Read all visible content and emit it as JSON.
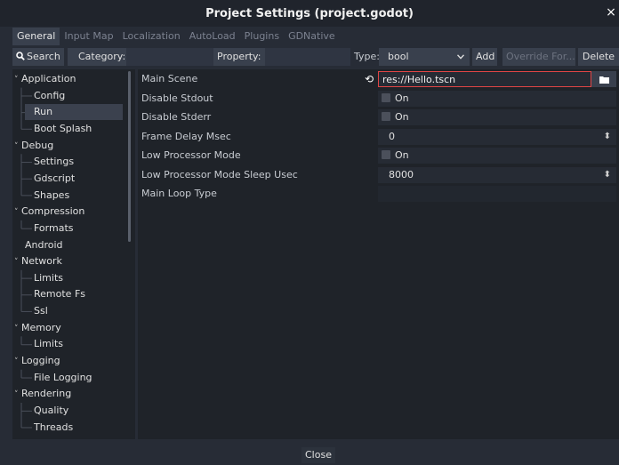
{
  "window": {
    "title": "Project Settings (project.godot)",
    "close_glyph": "×"
  },
  "tabs": [
    {
      "label": "General",
      "active": true
    },
    {
      "label": "Input Map"
    },
    {
      "label": "Localization"
    },
    {
      "label": "AutoLoad"
    },
    {
      "label": "Plugins"
    },
    {
      "label": "GDNative"
    }
  ],
  "toolbar": {
    "search_label": "Search",
    "category_label": "Category:",
    "category_value": "",
    "property_label": "Property:",
    "property_value": "",
    "type_label": "Type:",
    "type_value": "bool",
    "add_label": "Add",
    "override_label": "Override For...",
    "delete_label": "Delete"
  },
  "tree": [
    {
      "label": "Application",
      "level": 0,
      "expanded": true
    },
    {
      "label": "Config",
      "level": 1
    },
    {
      "label": "Run",
      "level": 1,
      "selected": true
    },
    {
      "label": "Boot Splash",
      "level": 1
    },
    {
      "label": "Debug",
      "level": 0,
      "expanded": true
    },
    {
      "label": "Settings",
      "level": 1
    },
    {
      "label": "Gdscript",
      "level": 1
    },
    {
      "label": "Shapes",
      "level": 1
    },
    {
      "label": "Compression",
      "level": 0,
      "expanded": true
    },
    {
      "label": "Formats",
      "level": 1
    },
    {
      "label": "Android",
      "level": 0,
      "expanded": false
    },
    {
      "label": "Network",
      "level": 0,
      "expanded": true
    },
    {
      "label": "Limits",
      "level": 1
    },
    {
      "label": "Remote Fs",
      "level": 1
    },
    {
      "label": "Ssl",
      "level": 1
    },
    {
      "label": "Memory",
      "level": 0,
      "expanded": true
    },
    {
      "label": "Limits",
      "level": 1
    },
    {
      "label": "Logging",
      "level": 0,
      "expanded": true
    },
    {
      "label": "File Logging",
      "level": 1
    },
    {
      "label": "Rendering",
      "level": 0,
      "expanded": true
    },
    {
      "label": "Quality",
      "level": 1
    },
    {
      "label": "Threads",
      "level": 1
    }
  ],
  "properties": [
    {
      "name": "Main Scene",
      "kind": "file",
      "value": "res://Hello.tscn",
      "revert": true
    },
    {
      "name": "Disable Stdout",
      "kind": "bool",
      "value": "On"
    },
    {
      "name": "Disable Stderr",
      "kind": "bool",
      "value": "On"
    },
    {
      "name": "Frame Delay Msec",
      "kind": "number",
      "value": "0"
    },
    {
      "name": "Low Processor Mode",
      "kind": "bool",
      "value": "On"
    },
    {
      "name": "Low Processor Mode Sleep Usec",
      "kind": "number",
      "value": "8000"
    },
    {
      "name": "Main Loop Type",
      "kind": "text",
      "value": ""
    }
  ],
  "footer": {
    "close_label": "Close"
  },
  "colors": {
    "accent": "#e04545",
    "background": "#272c36",
    "panel": "#1f2329",
    "selected": "#3b414e"
  }
}
